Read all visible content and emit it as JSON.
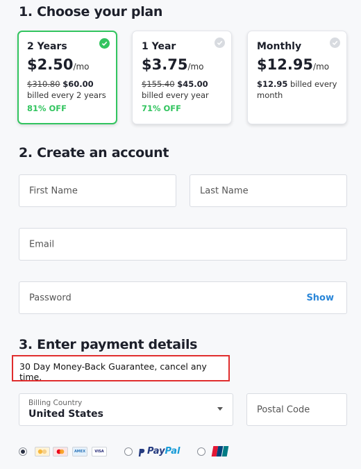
{
  "sections": {
    "plan_title": "1. Choose your plan",
    "account_title": "2. Create an account",
    "payment_title": "3. Enter payment details"
  },
  "plans": [
    {
      "name": "2 Years",
      "price": "$2.50",
      "per": "/mo",
      "old_price": "$310.80",
      "new_price": "$60.00",
      "billing": "billed every 2 years",
      "discount": "81% OFF",
      "selected": true
    },
    {
      "name": "1 Year",
      "price": "$3.75",
      "per": "/mo",
      "old_price": "$155.40",
      "new_price": "$45.00",
      "billing": "billed every year",
      "discount": "71% OFF",
      "selected": false
    },
    {
      "name": "Monthly",
      "price": "$12.95",
      "per": "/mo",
      "old_price": "",
      "new_price": "$12.95",
      "billing": "billed every month",
      "discount": "",
      "selected": false
    }
  ],
  "account": {
    "first_name_placeholder": "First Name",
    "last_name_placeholder": "Last Name",
    "email_placeholder": "Email",
    "password_placeholder": "Password",
    "show_label": "Show"
  },
  "payment": {
    "guarantee": "30 Day Money-Back Guarantee, cancel any time.",
    "country_label": "Billing Country",
    "country_value": "United States",
    "postal_placeholder": "Postal Code",
    "methods": [
      {
        "name": "cards",
        "selected": true,
        "cards": [
          "AMEX",
          "VISA"
        ]
      },
      {
        "name": "paypal",
        "selected": false,
        "label_a": "Pay",
        "label_b": "Pal"
      },
      {
        "name": "unionpay",
        "selected": false,
        "label": "UnionPay"
      }
    ]
  },
  "colors": {
    "accent_green": "#32c45f",
    "link_blue": "#2a86d8",
    "highlight_red": "#e02d2d"
  }
}
